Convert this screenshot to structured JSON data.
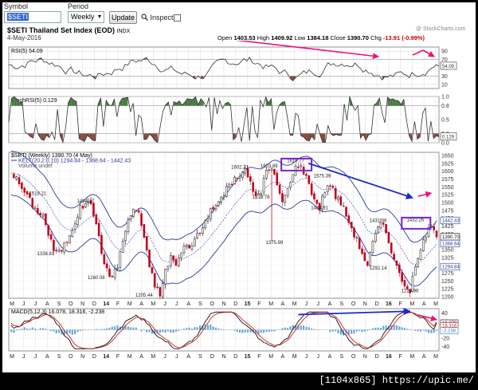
{
  "controls": {
    "symbol_label": "Symbol",
    "symbol_value": "$SETI",
    "period_label": "Period",
    "period_value": "Weekly",
    "update_label": "Update",
    "inspect_label": "Inspect"
  },
  "chart_header": {
    "title": "$SETI Thailand Set Index (EOD)",
    "exchange": "INDX",
    "date": "4-May-2016",
    "watermark": "@ StockCharts.com",
    "open_label": "Open",
    "open": "1403.53",
    "high_label": "High",
    "high": "1409.92",
    "low_label": "Low",
    "low": "1384.18",
    "close_label": "Close",
    "close": "1390.70",
    "chg_label": "Chg",
    "chg": "-13.91 (-0.99%)"
  },
  "rsi_panel": {
    "label": "RSI(5) 54.09",
    "ticks": [
      "90",
      "70",
      "50",
      "30",
      "10"
    ],
    "current_value": "54.09"
  },
  "stochrsi_panel": {
    "label": "StochRSI(5) 0.129",
    "ticks": [
      "1.0",
      "0.8",
      "0.5",
      "0.2",
      "0.0"
    ],
    "current_value": "0.129"
  },
  "price_panel": {
    "label": "$SETI (Weekly) 1390.70 (4 May)",
    "kelt_label": "KELT(20,2.0,10) 1294.84 - 1368.64 - 1442.43",
    "volume_label": "Volume undef",
    "ticks": [
      "1650",
      "1625",
      "1600",
      "1575",
      "1550",
      "1525",
      "1500",
      "1475",
      "1450",
      "1425",
      "1400",
      "1375",
      "1350",
      "1325",
      "1300",
      "1275",
      "1250",
      "1225",
      "1200"
    ],
    "annotations": [
      "1602.21",
      "1603.89",
      "1619.77",
      "1575.39",
      "1519.21",
      "1494.27",
      "1519.76",
      "1484.91",
      "1431.06",
      "1432.26",
      "1338.81",
      "1260.08",
      "1205.44",
      "1375.99",
      "1292.14",
      "1220.96"
    ],
    "kelt_upper_value": "1442.43",
    "price_value": "1390.70",
    "kelt_middle_value": "1368.64",
    "kelt_lower_value": "1294.84",
    "x_axis": [
      "M",
      "J",
      "J",
      "A",
      "S",
      "O",
      "N",
      "D",
      "14",
      "F",
      "M",
      "A",
      "M",
      "J",
      "J",
      "A",
      "S",
      "O",
      "N",
      "D",
      "15",
      "F",
      "M",
      "A",
      "M",
      "J",
      "J",
      "A",
      "S",
      "O",
      "N",
      "D",
      "16",
      "F",
      "M",
      "A",
      "M"
    ]
  },
  "macd_panel": {
    "label": "MACD(5,12,3) 16.078, 18.316, -2.238",
    "ticks": [
      "40",
      "20",
      "0",
      "-20",
      "-40"
    ],
    "macd_value": "16.078",
    "signal_value": "18.316",
    "hist_value": "-2.238",
    "x_axis": [
      "M",
      "J",
      "J",
      "A",
      "S",
      "O",
      "N",
      "D",
      "14",
      "F",
      "M",
      "A",
      "M",
      "J",
      "J",
      "A",
      "S",
      "O",
      "N",
      "D",
      "15",
      "F",
      "M",
      "A",
      "M",
      "J",
      "J",
      "A",
      "S",
      "O",
      "N",
      "D",
      "16",
      "F",
      "M",
      "A",
      "M"
    ]
  },
  "footer": {
    "text": "[1104x865] https://upic.me/"
  },
  "colors": {
    "rsi_fill_high": "#4b7a44",
    "rsi_fill_low": "#8a4a40",
    "candle_down": "#c0001a",
    "keltner": "#2a3a9a",
    "annotation_magenta": "#ee1177",
    "annotation_blue": "#1a2acc",
    "annotation_box": "#7a22cc"
  }
}
